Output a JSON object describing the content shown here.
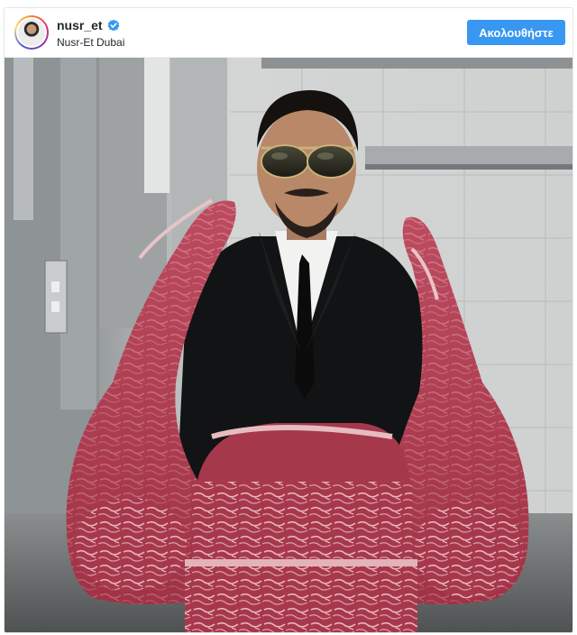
{
  "post": {
    "username": "nusr_et",
    "verified": true,
    "location": "Nusr-Et Dubai",
    "follow_label": "Ακολουθήστε",
    "accent_color": "#3897f0",
    "photo": {
      "icon": "photo-image"
    }
  }
}
